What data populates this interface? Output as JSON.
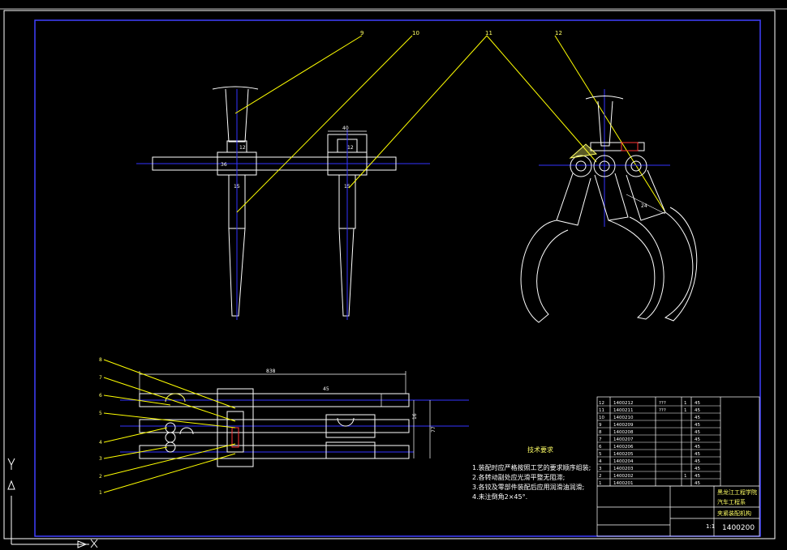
{
  "colors": {
    "background": "#000000",
    "line": "#ffffff",
    "center": "#2222ff",
    "leader": "#ffff00",
    "dim": "#ffffff",
    "highlight": "#ffff66",
    "red": "#ff3333"
  },
  "balloons": {
    "n9": "9",
    "n10": "10",
    "n11": "11",
    "n12": "12",
    "n1": "1",
    "n2": "2",
    "n3": "3",
    "n4": "4",
    "n5": "5",
    "n6": "6",
    "n7": "7",
    "n8": "8"
  },
  "dims": {
    "d40": "40",
    "d12a": "12",
    "d12b": "12",
    "d15a": "15",
    "d15b": "15",
    "d36": "36",
    "d838": "838",
    "d16": "16",
    "d77": "77",
    "d24": "24",
    "d45": "45"
  },
  "notes": {
    "title": "技术要求",
    "line1": "1.装配时应严格按照工艺的要求顺序组装;",
    "line2": "2.各转动副处应光滑平整无阻滞;",
    "line3": "3.各铰及零部件装配后应用润滑油润滑;",
    "line4": "4.未注倒角2×45°."
  },
  "bom": [
    {
      "no": "12",
      "code": "1400212",
      "name": "???",
      "qty": "1",
      "mat": "45"
    },
    {
      "no": "11",
      "code": "1400211",
      "name": "???",
      "qty": "1",
      "mat": "45"
    },
    {
      "no": "10",
      "code": "1400210",
      "name": "",
      "qty": "",
      "mat": "45"
    },
    {
      "no": "9",
      "code": "1400209",
      "name": "",
      "qty": "",
      "mat": "45"
    },
    {
      "no": "8",
      "code": "1400208",
      "name": "",
      "qty": "",
      "mat": "45"
    },
    {
      "no": "7",
      "code": "1400207",
      "name": "",
      "qty": "",
      "mat": "45"
    },
    {
      "no": "6",
      "code": "1400206",
      "name": "",
      "qty": "",
      "mat": "45"
    },
    {
      "no": "5",
      "code": "1400205",
      "name": "",
      "qty": "",
      "mat": "45"
    },
    {
      "no": "4",
      "code": "1400204",
      "name": "",
      "qty": "",
      "mat": "45"
    },
    {
      "no": "3",
      "code": "1400203",
      "name": "",
      "qty": "",
      "mat": "45"
    },
    {
      "no": "2",
      "code": "1400202",
      "name": "",
      "qty": "1",
      "mat": "45"
    },
    {
      "no": "1",
      "code": "1400201",
      "name": "",
      "qty": "",
      "mat": "45"
    }
  ],
  "titleblock": {
    "school": "黑龙江工程学院",
    "dept": "汽车工程系",
    "drawing_name": "夹紧装配机构",
    "drawing_no": "1400200",
    "scale": "1:1"
  }
}
